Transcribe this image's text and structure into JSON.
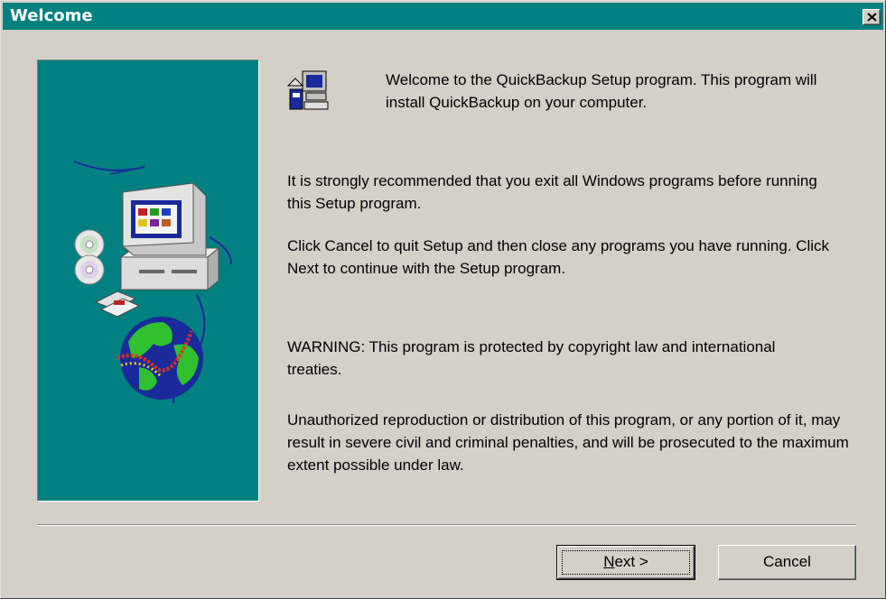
{
  "window": {
    "title": "Welcome"
  },
  "titlebar": {
    "close_icon": "close-icon"
  },
  "content": {
    "intro": "Welcome to the QuickBackup Setup program.  This program will install QuickBackup on your computer.",
    "recommend": "It is strongly recommended that you exit all Windows programs before running this Setup program.",
    "instructions": "Click Cancel to quit Setup and then close any programs you have running.  Click Next to continue with the Setup program.",
    "warning": "WARNING: This program is protected by copyright law and international treaties.",
    "legal": "Unauthorized reproduction or distribution of this program, or any portion of it, may result in severe civil and criminal penalties, and will be prosecuted to the maximum extent possible under law."
  },
  "icons": {
    "setup": "setup-computer-icon",
    "art": "computer-globe-illustration"
  },
  "buttons": {
    "next_mnemonic": "N",
    "next_rest": "ext >",
    "cancel": "Cancel"
  },
  "colors": {
    "titlebar": "#008080",
    "panel": "#008080",
    "face": "#d4d0c8"
  }
}
